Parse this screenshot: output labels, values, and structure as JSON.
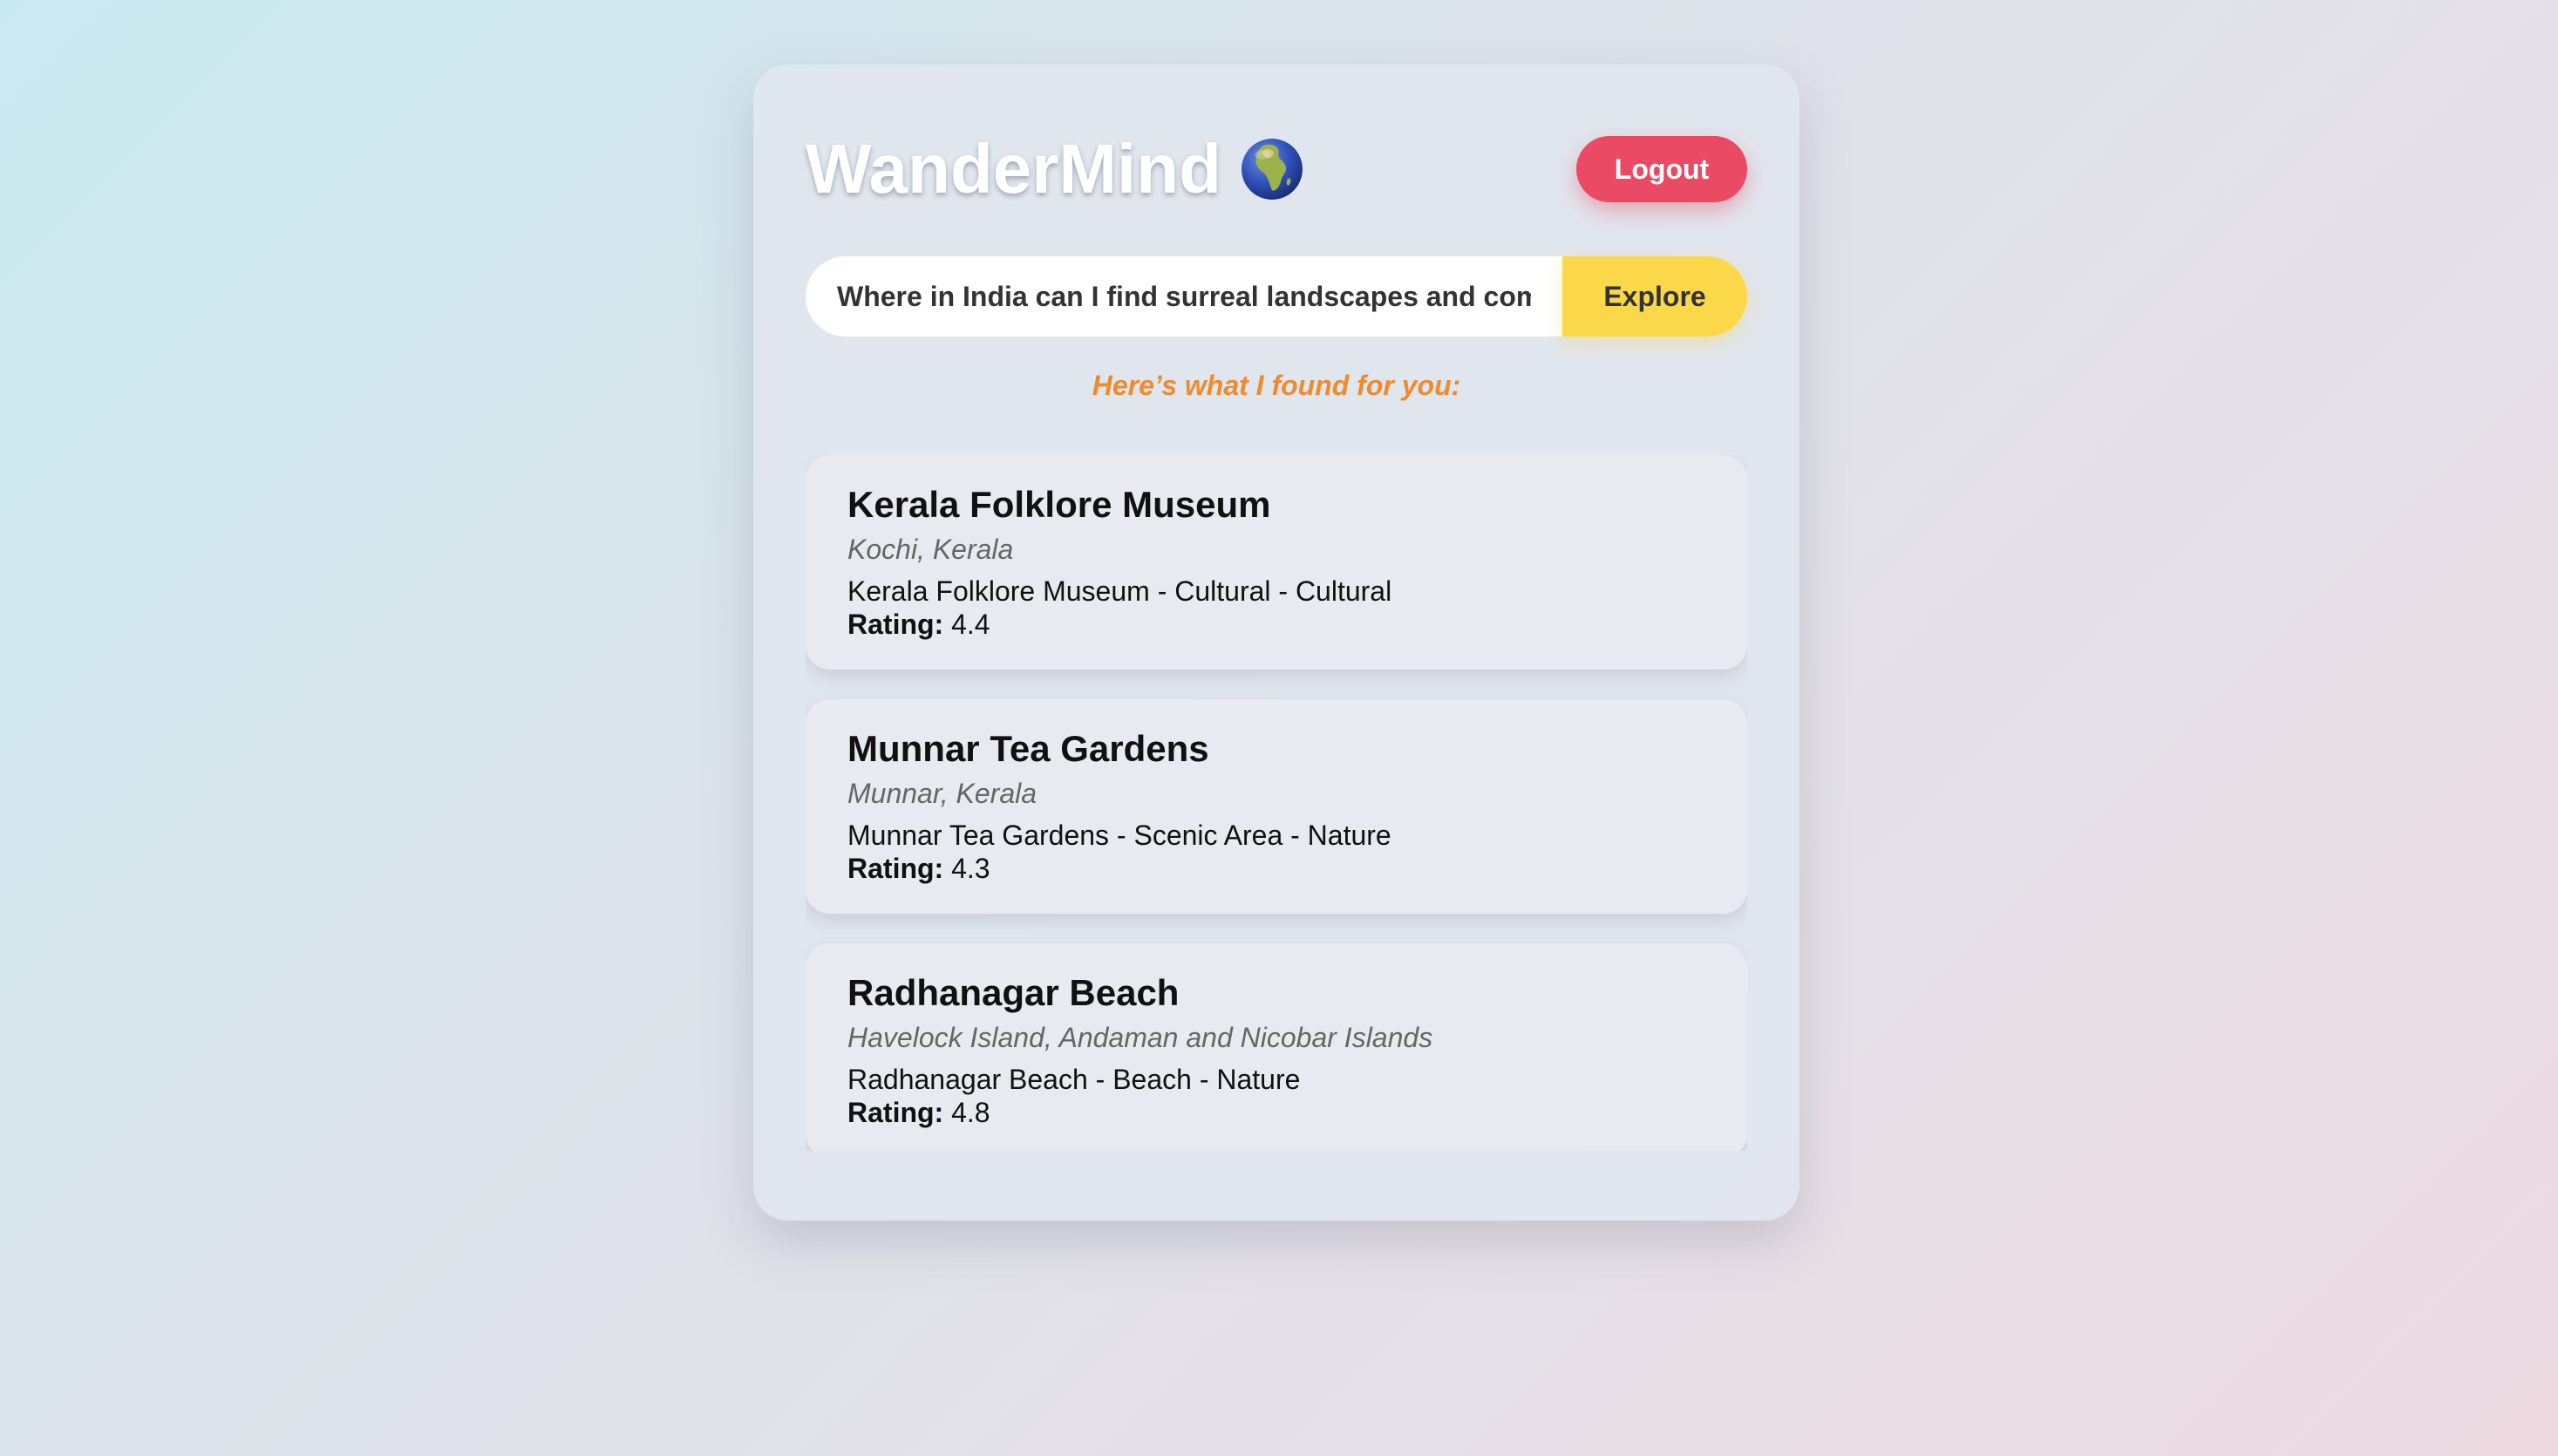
{
  "app": {
    "title": "WanderMind",
    "title_icon": "globe-africa-icon"
  },
  "header": {
    "logout_label": "Logout"
  },
  "search": {
    "value": "Where in India can I find surreal landscapes and com",
    "button_label": "Explore"
  },
  "results": {
    "heading": "Here’s what I found for you:",
    "rating_label": "Rating:",
    "items": [
      {
        "name": "Kerala Folklore Museum",
        "location": "Kochi, Kerala",
        "description": "Kerala Folklore Museum - Cultural - Cultural",
        "rating": "4.4"
      },
      {
        "name": "Munnar Tea Gardens",
        "location": "Munnar, Kerala",
        "description": "Munnar Tea Gardens - Scenic Area - Nature",
        "rating": "4.3"
      },
      {
        "name": "Radhanagar Beach",
        "location": "Havelock Island, Andaman and Nicobar Islands",
        "description": "Radhanagar Beach - Beach - Nature",
        "rating": "4.8"
      }
    ]
  },
  "colors": {
    "logout": "#ea4a63",
    "explore": "#fad84a",
    "heading_accent": "#f08a2e"
  }
}
